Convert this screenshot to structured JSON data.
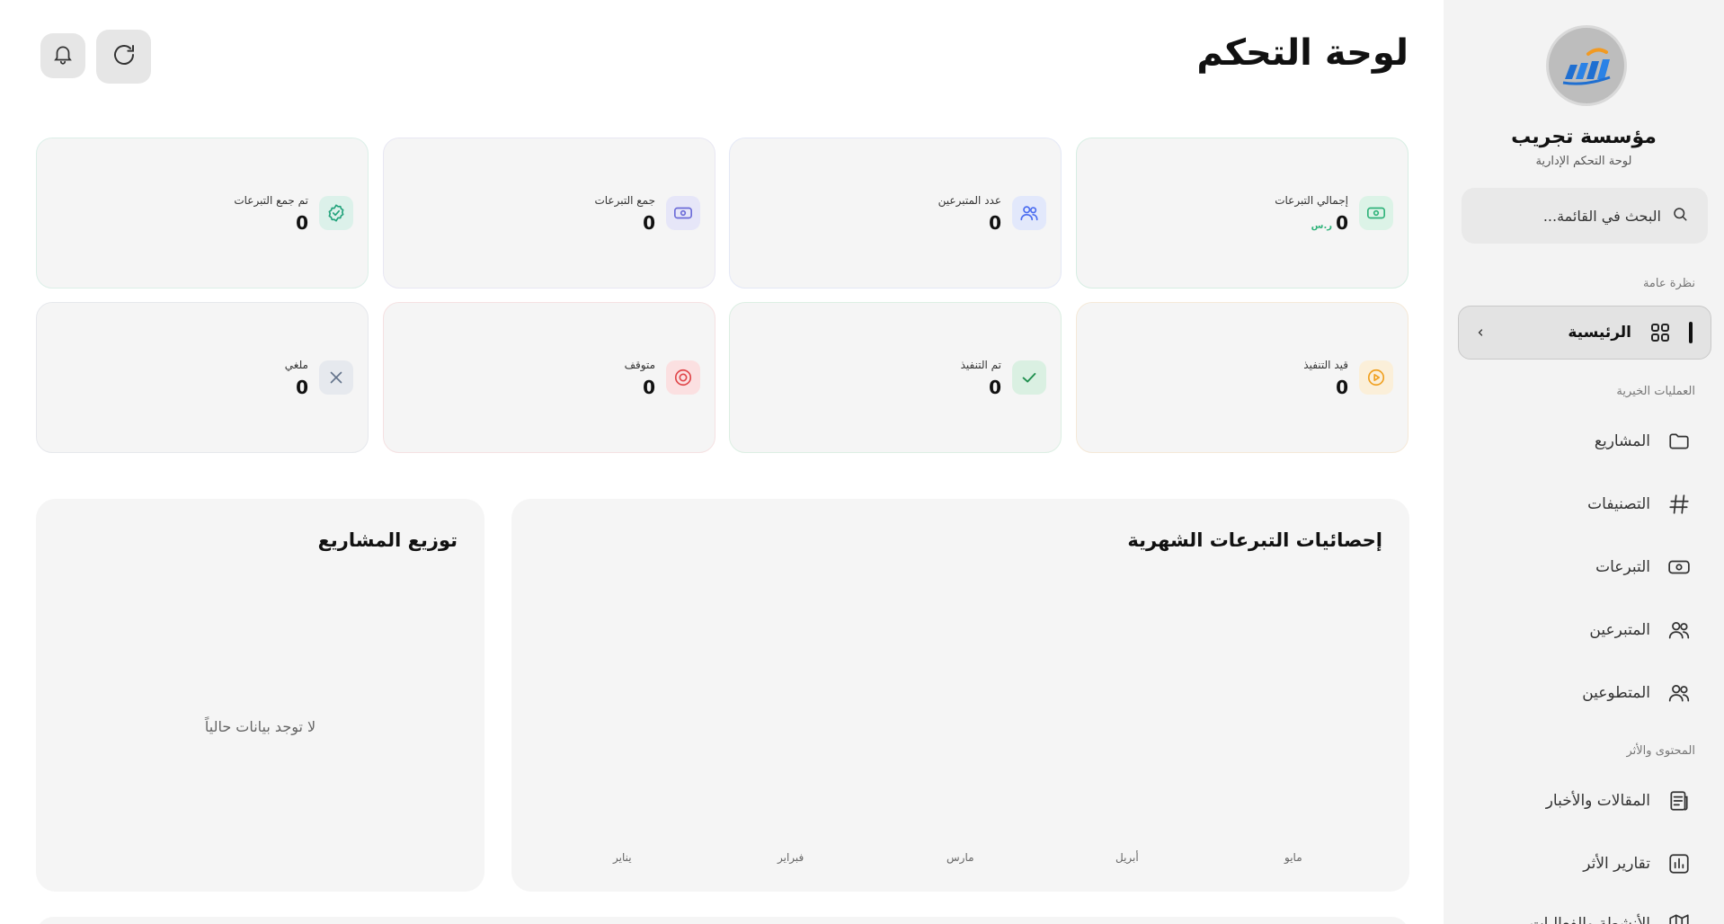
{
  "sidebar": {
    "org_name": "مؤسسة تجريب",
    "org_subtitle": "لوحة التحكم الإدارية",
    "search": {
      "placeholder": "البحث في القائمة..."
    },
    "sections": {
      "overview": "نظرة عامة",
      "charity": "العمليات الخيرية",
      "content": "المحتوى والأثر"
    },
    "items": {
      "home": "الرئيسية",
      "projects": "المشاريع",
      "categories": "التصنيفات",
      "donations": "التبرعات",
      "donors": "المتبرعين",
      "volunteers": "المتطوعين",
      "articles": "المقالات والأخبار",
      "impact": "تقارير الأثر",
      "partial": "الأنشطة والفعاليات"
    }
  },
  "header": {
    "title": "لوحة التحكم"
  },
  "stats": {
    "total_donations": {
      "label": "إجمالي التبرعات",
      "value": "0",
      "unit": "ر.س"
    },
    "donors_count": {
      "label": "عدد المتبرعين",
      "value": "0"
    },
    "collecting": {
      "label": "جمع التبرعات",
      "value": "0"
    },
    "collected": {
      "label": "تم جمع التبرعات",
      "value": "0"
    },
    "in_progress": {
      "label": "قيد التنفيذ",
      "value": "0"
    },
    "done": {
      "label": "تم التنفيذ",
      "value": "0"
    },
    "stopped": {
      "label": "متوقف",
      "value": "0"
    },
    "cancelled": {
      "label": "ملغي",
      "value": "0"
    }
  },
  "monthly_panel": {
    "title": "إحصائيات التبرعات الشهرية",
    "months": [
      "مايو",
      "أبريل",
      "مارس",
      "فبراير",
      "يناير"
    ]
  },
  "distribution_panel": {
    "title": "توزيع المشاريع",
    "empty": "لا توجد بيانات حالياً"
  },
  "colors": {
    "green": "#2fb37a",
    "blue": "#4a6cf0",
    "indigo": "#6b6bd8",
    "teal": "#23a37c",
    "orange": "#f0a020",
    "check": "#1f8f4e",
    "red": "#e0464a",
    "slate": "#64748b"
  }
}
